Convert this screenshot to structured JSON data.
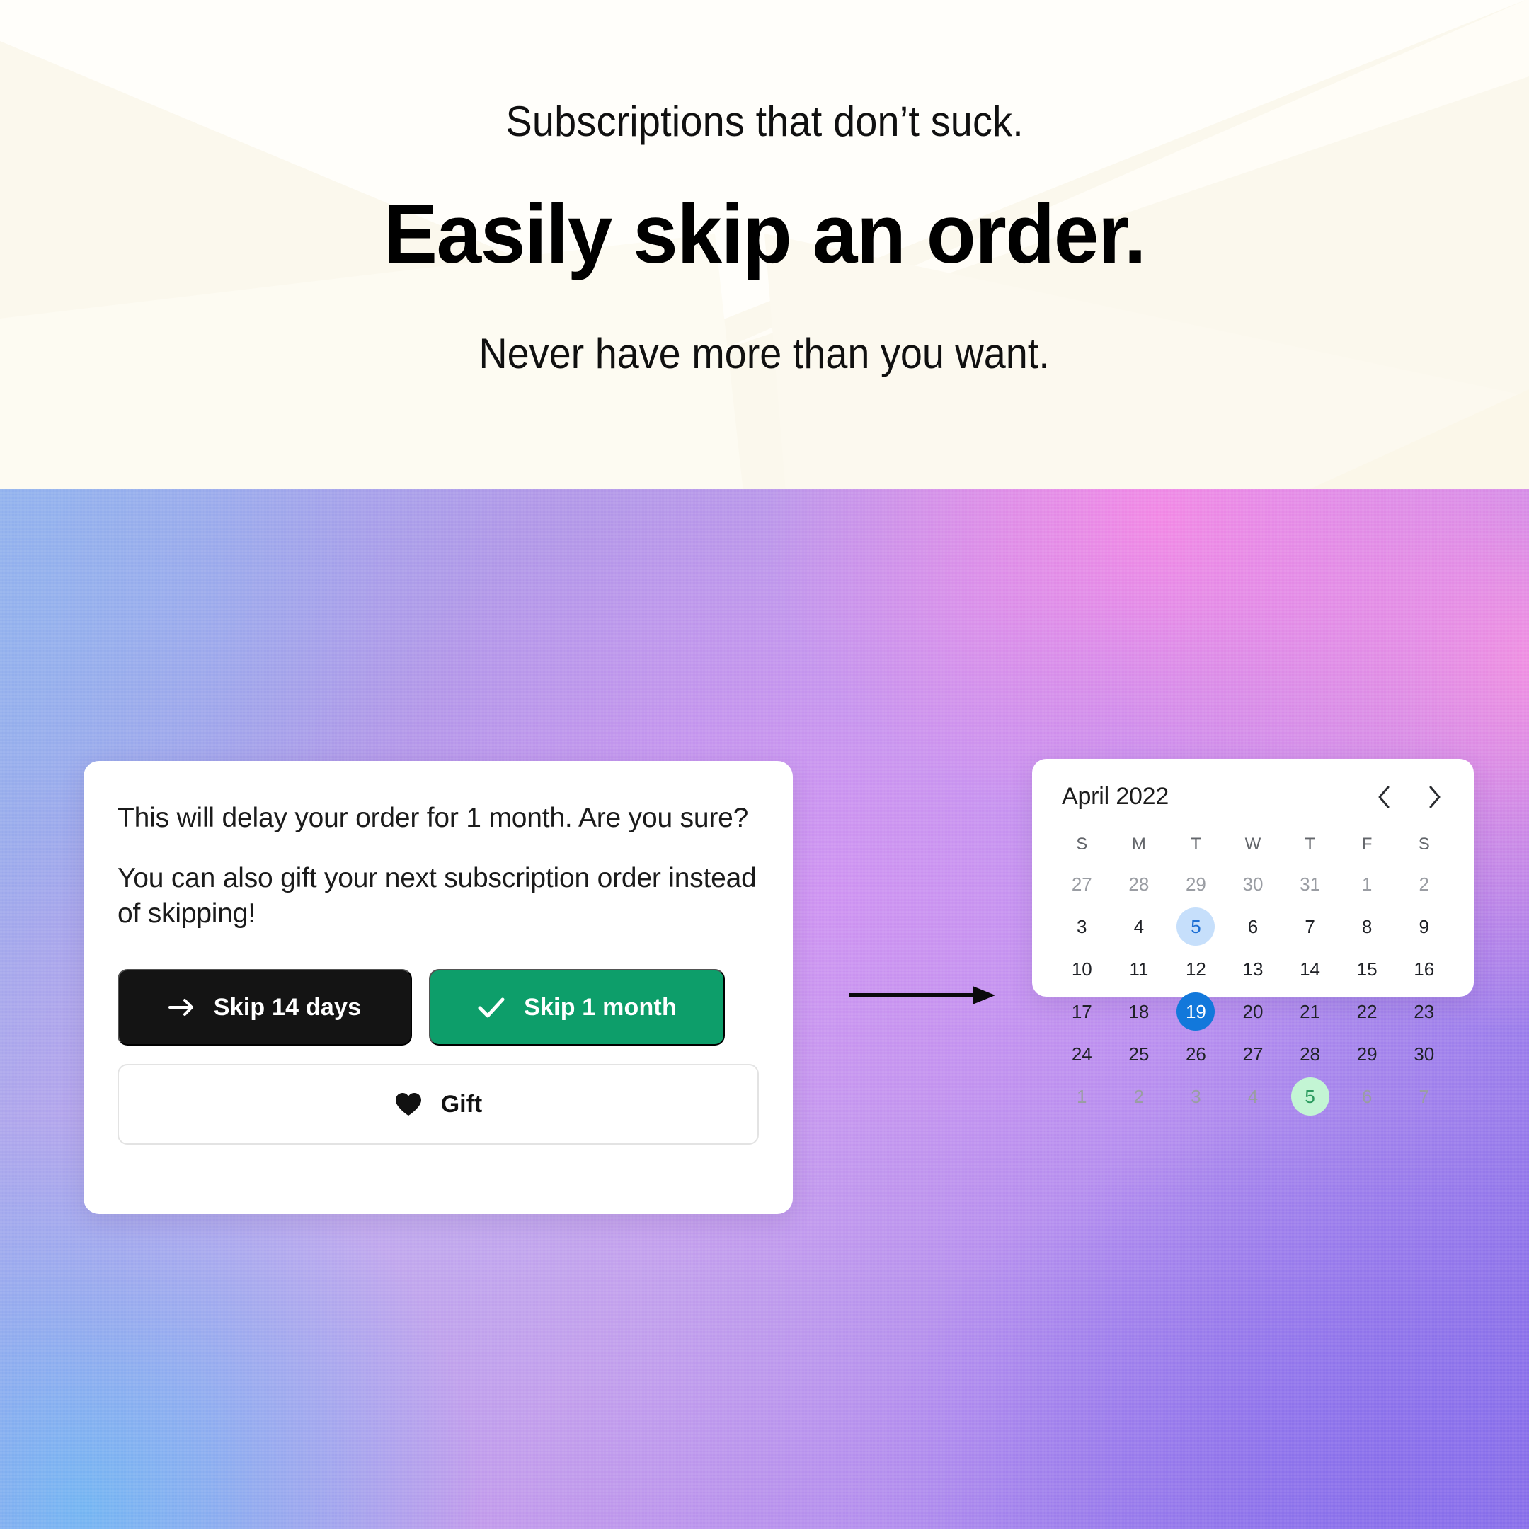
{
  "hero": {
    "eyebrow": "Subscriptions that don’t suck.",
    "headline": "Easily skip an order.",
    "subline": "Never have more than you want."
  },
  "dialog": {
    "question": "This will delay your order for 1 month. Are you sure?",
    "note": "You can also gift your next subscription order instead of skipping!",
    "buttons": {
      "skip_14_days": "Skip 14 days",
      "skip_1_month": "Skip 1 month",
      "gift": "Gift"
    },
    "icons": {
      "skip_14_days": "arrow-right-icon",
      "skip_1_month": "check-icon",
      "gift": "heart-icon"
    }
  },
  "flow": {
    "arrow": "arrow-right-connector"
  },
  "calendar": {
    "title": "April 2022",
    "prev_icon": "chevron-left-icon",
    "next_icon": "chevron-right-icon",
    "weekdays": [
      "S",
      "M",
      "T",
      "W",
      "T",
      "F",
      "S"
    ],
    "weeks": [
      [
        {
          "label": "27",
          "state": "muted"
        },
        {
          "label": "28",
          "state": "muted"
        },
        {
          "label": "29",
          "state": "muted"
        },
        {
          "label": "30",
          "state": "muted"
        },
        {
          "label": "31",
          "state": "muted"
        },
        {
          "label": "1",
          "state": "muted"
        },
        {
          "label": "2",
          "state": "muted"
        }
      ],
      [
        {
          "label": "3",
          "state": "normal"
        },
        {
          "label": "4",
          "state": "normal"
        },
        {
          "label": "5",
          "state": "sel-light"
        },
        {
          "label": "6",
          "state": "normal"
        },
        {
          "label": "7",
          "state": "normal"
        },
        {
          "label": "8",
          "state": "normal"
        },
        {
          "label": "9",
          "state": "normal"
        }
      ],
      [
        {
          "label": "10",
          "state": "normal"
        },
        {
          "label": "11",
          "state": "normal"
        },
        {
          "label": "12",
          "state": "normal"
        },
        {
          "label": "13",
          "state": "normal"
        },
        {
          "label": "14",
          "state": "normal"
        },
        {
          "label": "15",
          "state": "normal"
        },
        {
          "label": "16",
          "state": "normal"
        }
      ],
      [
        {
          "label": "17",
          "state": "normal"
        },
        {
          "label": "18",
          "state": "normal"
        },
        {
          "label": "19",
          "state": "sel-solid"
        },
        {
          "label": "20",
          "state": "normal"
        },
        {
          "label": "21",
          "state": "normal"
        },
        {
          "label": "22",
          "state": "normal"
        },
        {
          "label": "23",
          "state": "normal"
        }
      ],
      [
        {
          "label": "24",
          "state": "normal"
        },
        {
          "label": "25",
          "state": "normal"
        },
        {
          "label": "26",
          "state": "normal"
        },
        {
          "label": "27",
          "state": "normal"
        },
        {
          "label": "28",
          "state": "normal"
        },
        {
          "label": "29",
          "state": "normal"
        },
        {
          "label": "30",
          "state": "normal"
        }
      ],
      [
        {
          "label": "1",
          "state": "muted"
        },
        {
          "label": "2",
          "state": "muted"
        },
        {
          "label": "3",
          "state": "muted"
        },
        {
          "label": "4",
          "state": "muted"
        },
        {
          "label": "5",
          "state": "sel-green"
        },
        {
          "label": "6",
          "state": "muted"
        },
        {
          "label": "7",
          "state": "muted"
        }
      ]
    ]
  },
  "colors": {
    "hero_bg": "#fbf8ed",
    "skip_14_days_bg": "#141414",
    "skip_1_month_bg": "#0d9e6a",
    "gift_border": "#e3e3e3",
    "selected_day_bg": "#1278db",
    "preview_day_bg": "#c6dffb",
    "new_date_bg": "#c3f5d4",
    "card_bg": "#ffffff"
  }
}
